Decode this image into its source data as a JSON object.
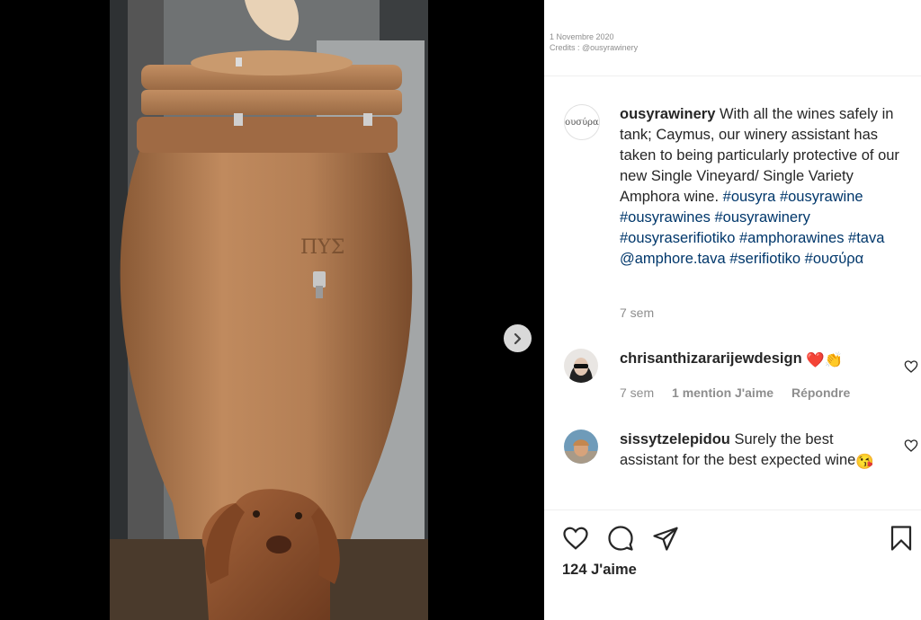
{
  "photo": {
    "alt_icon": "amphora-photo"
  },
  "carousel": {
    "next_icon": "chevron-right-icon"
  },
  "meta": {
    "date": "1 Novembre 2020",
    "credits": "Credits : @ousyrawinery"
  },
  "post": {
    "avatar_text": "ουσύρα",
    "username": "ousyrawinery",
    "caption": "With all the wines safely in tank; Caymus, our winery assistant has taken to being particularly protective of our new Single Vineyard/ Single Variety Amphora wine.",
    "hashtags": "#ousyra #ousyrawine #ousyrawines #ousyrawinery #ousyraserifiotiko #amphorawines #tava @amphore.tava #serifiotiko #ουσύρα",
    "time": "7 sem"
  },
  "comments": [
    {
      "username": "chrisanthizararijewdesign",
      "text": "",
      "emoji": "❤️👏",
      "time": "7 sem",
      "likes": "1 mention J'aime",
      "reply": "Répondre"
    },
    {
      "username": "sissytzelepidou",
      "text": "Surely the best assistant for the best expected wine",
      "emoji": "😘"
    }
  ],
  "actions": {
    "like_icon": "heart-icon",
    "comment_icon": "comment-icon",
    "share_icon": "share-icon",
    "save_icon": "bookmark-icon"
  },
  "likes": "124 J'aime"
}
